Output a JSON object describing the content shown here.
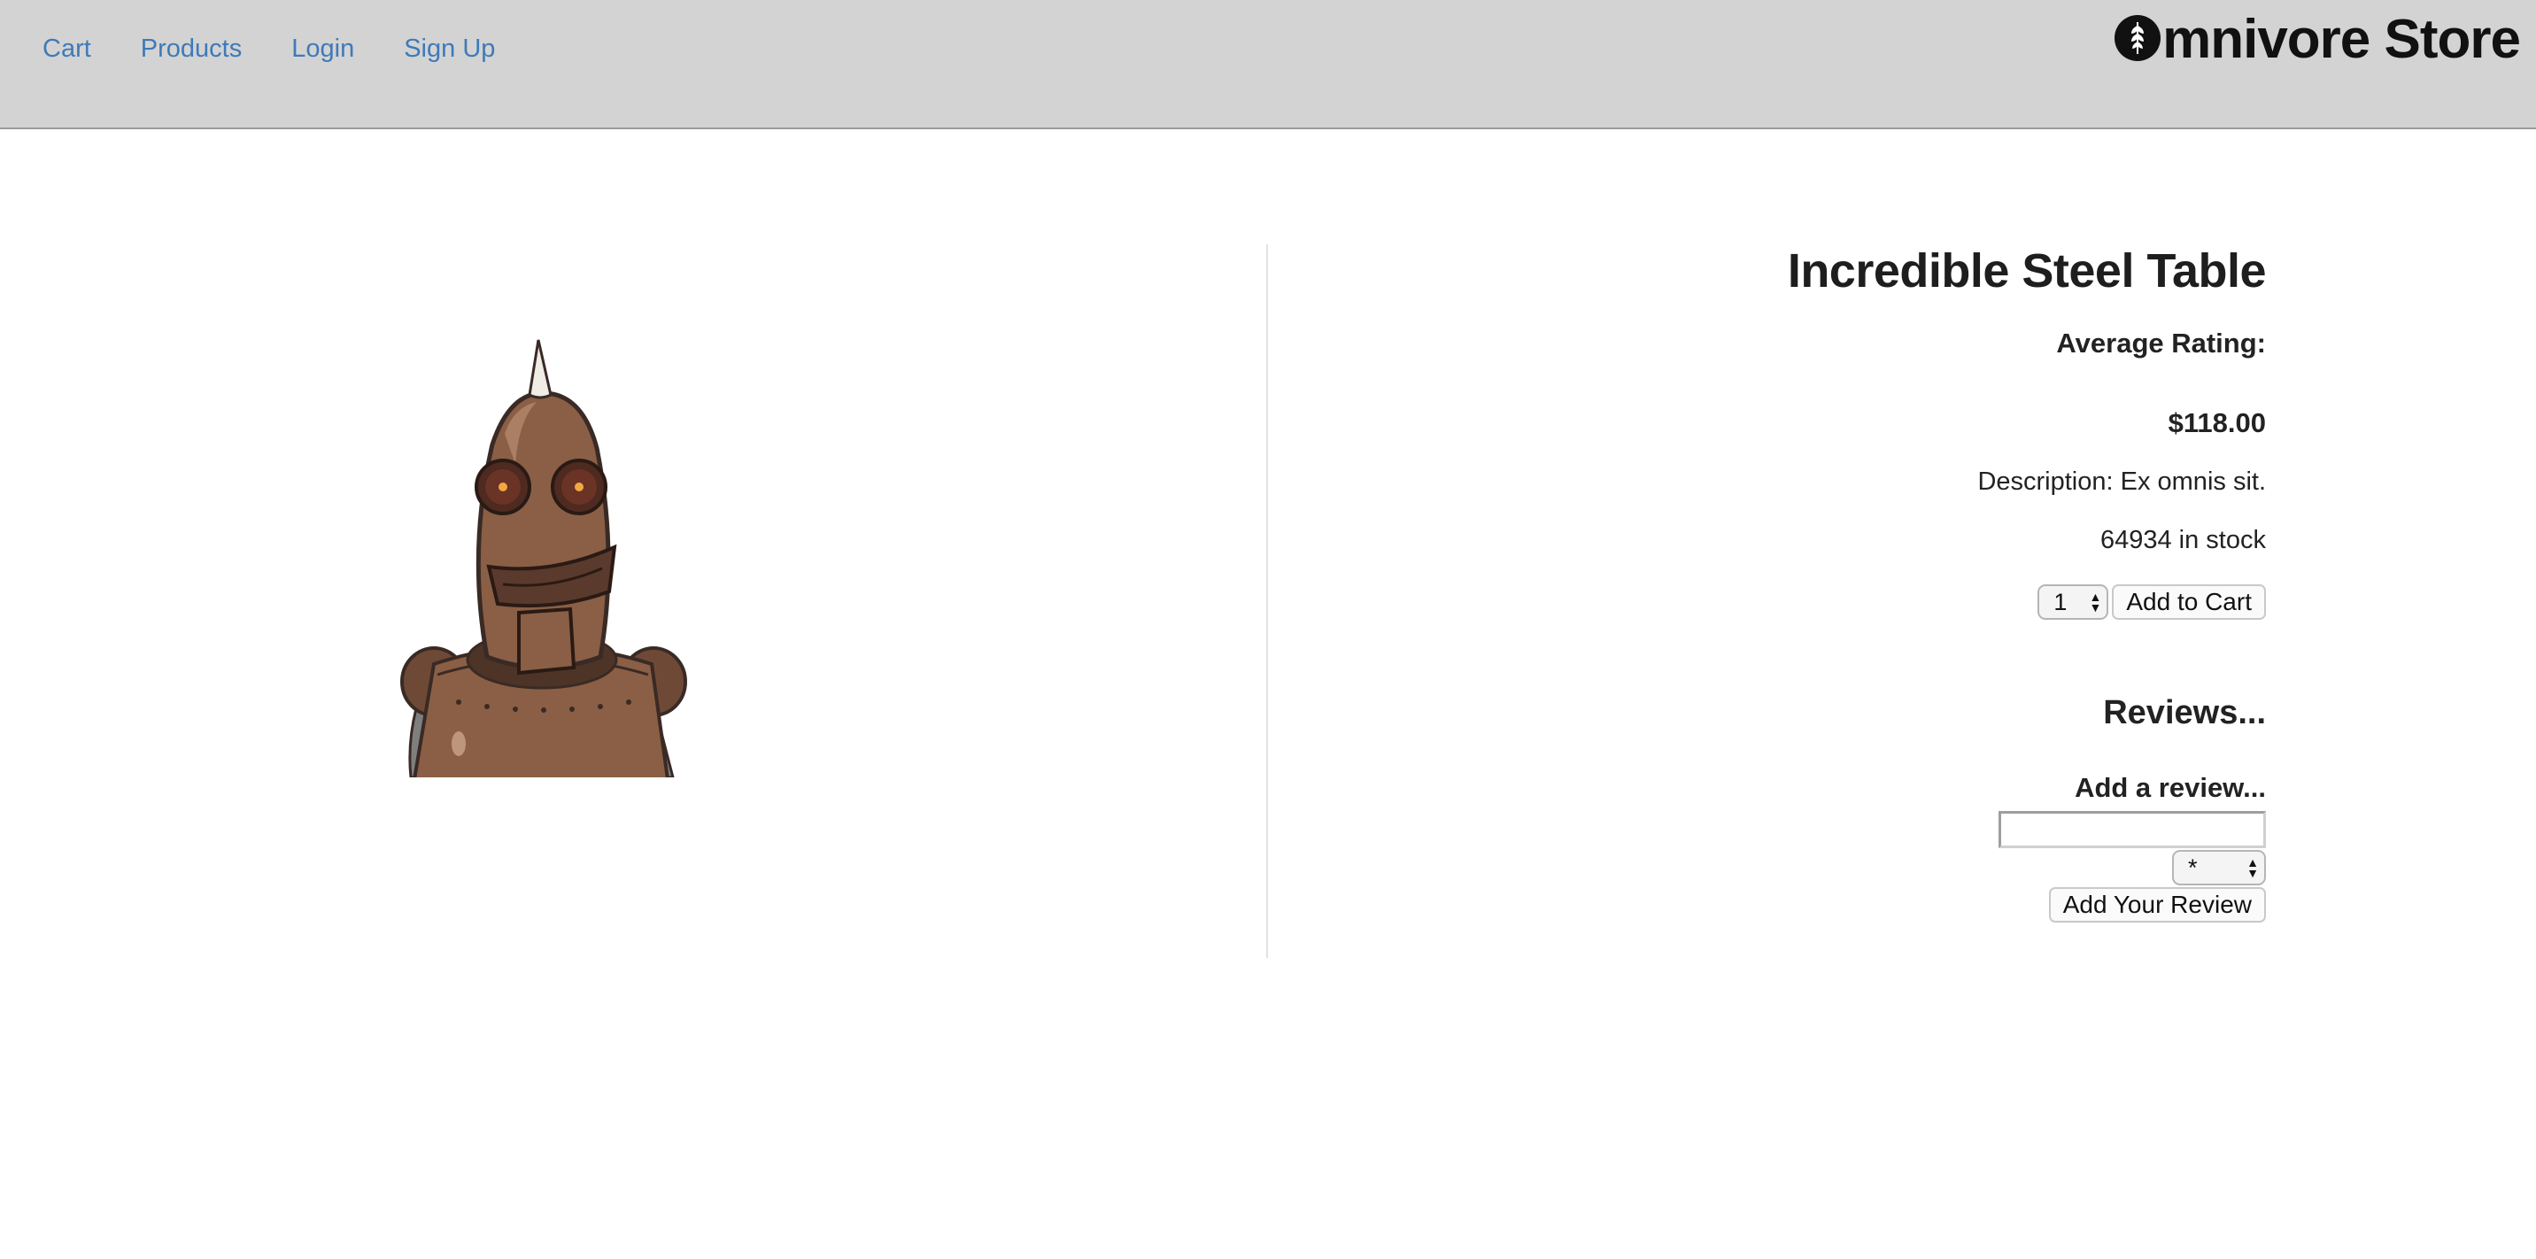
{
  "nav": {
    "items": [
      {
        "label": "Cart"
      },
      {
        "label": "Products"
      },
      {
        "label": "Login"
      },
      {
        "label": "Sign Up"
      }
    ]
  },
  "brand": {
    "name": "mnivore Store",
    "logo_icon": "wheat-leaf-icon"
  },
  "product": {
    "title": "Incredible Steel Table",
    "rating_label": "Average Rating:",
    "price": "$118.00",
    "description": "Description: Ex omnis sit.",
    "stock": "64934 in stock",
    "image_icon": "robot-illustration"
  },
  "cart": {
    "quantity_value": "1",
    "add_to_cart_label": "Add to Cart"
  },
  "reviews": {
    "heading": "Reviews...",
    "add_heading": "Add a review...",
    "input_value": "",
    "rating_value": "*",
    "submit_label": "Add Your Review"
  },
  "colors": {
    "header_bg": "#d3d3d3",
    "link": "#3e7ab8"
  }
}
